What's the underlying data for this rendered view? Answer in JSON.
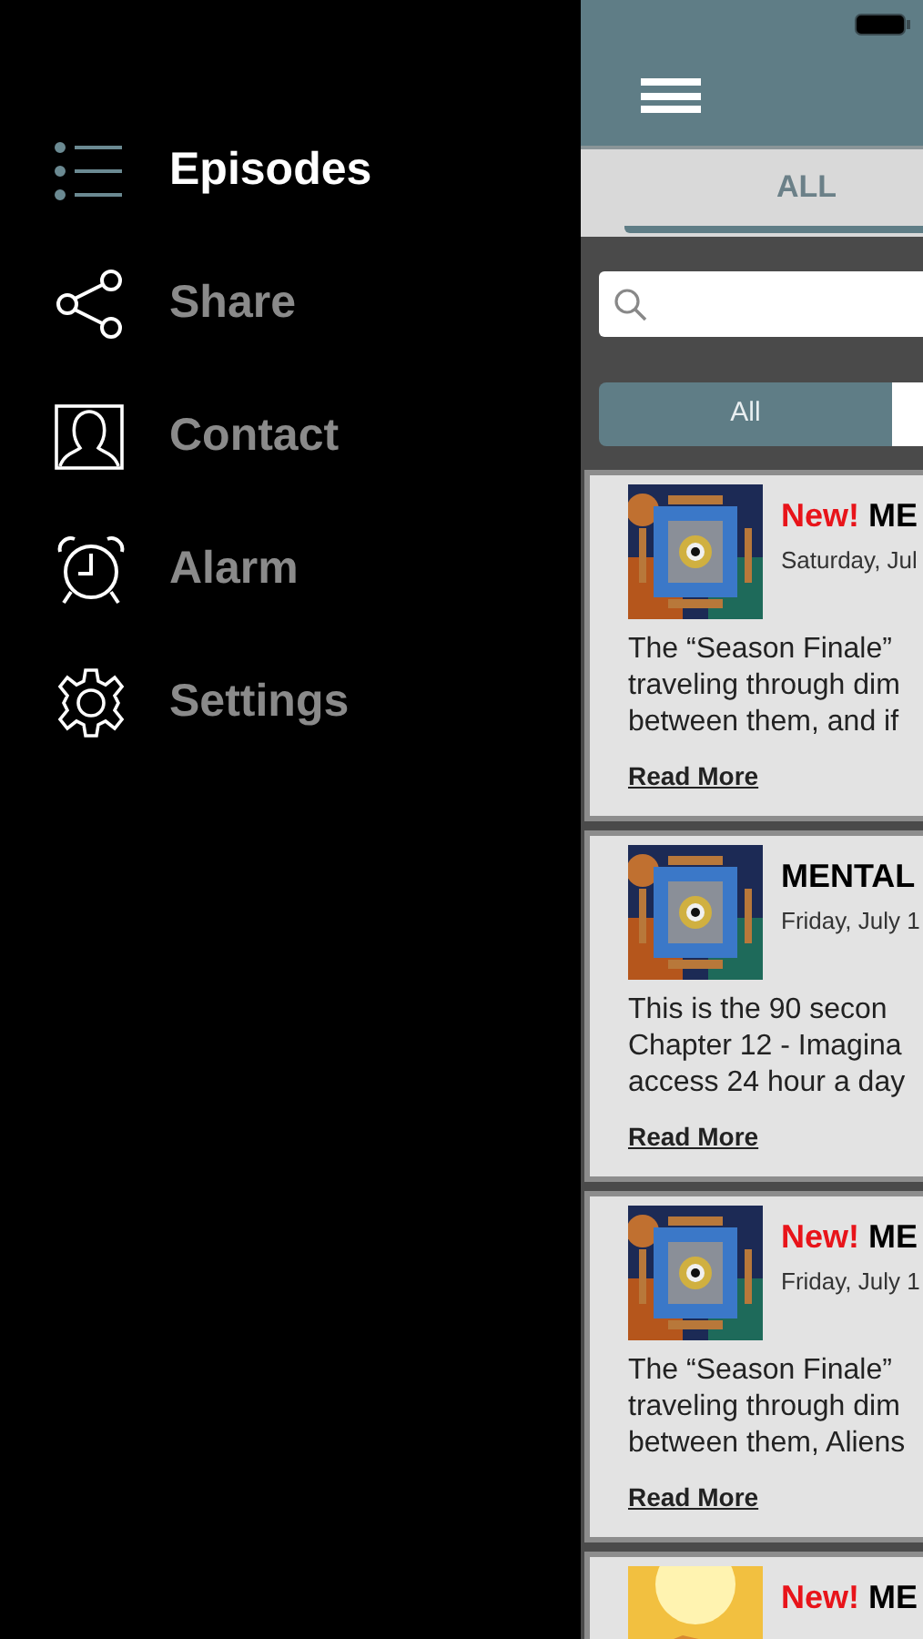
{
  "drawer": {
    "items": [
      {
        "label": "Episodes",
        "selected": true,
        "kind": "list"
      },
      {
        "label": "Share",
        "selected": false,
        "kind": "share"
      },
      {
        "label": "Contact",
        "selected": false,
        "kind": "contact"
      },
      {
        "label": "Alarm",
        "selected": false,
        "kind": "alarm"
      },
      {
        "label": "Settings",
        "selected": false,
        "kind": "settings"
      }
    ]
  },
  "tabs": [
    {
      "label": "ALL",
      "selected": true
    }
  ],
  "segments": [
    {
      "label": "All",
      "selected": true
    },
    {
      "selected": false
    }
  ],
  "episodes": [
    {
      "badge": "New!",
      "title": "ME",
      "date": "Saturday, Jul",
      "body": [
        "The “Season Finale”",
        "traveling through dim",
        "between them, and if"
      ],
      "link": "Read More"
    },
    {
      "title": "MENTAL",
      "date": "Friday, July 1",
      "body": [
        "This is the 90 secon",
        "Chapter 12 - Imagina",
        "access 24 hour a day"
      ],
      "link": "Read More"
    },
    {
      "badge": "New!",
      "title": "ME",
      "date": "Friday, July 1",
      "body": [
        "The “Season Finale”",
        "traveling through dim",
        "between them, Aliens"
      ],
      "link": "Read More"
    },
    {
      "badge": "New!",
      "title": "ME"
    }
  ]
}
